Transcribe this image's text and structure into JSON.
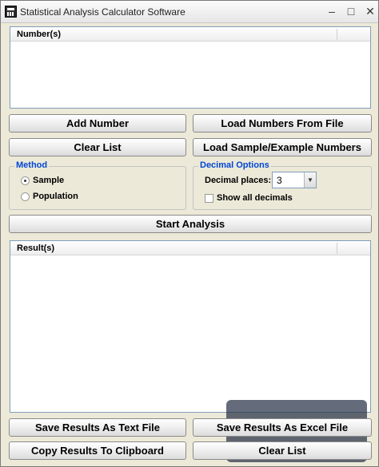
{
  "window": {
    "title": "Statistical Analysis Calculator Software",
    "minimize": "–",
    "maximize": "□",
    "close": "✕"
  },
  "numbers_panel": {
    "header": "Number(s)"
  },
  "buttons": {
    "add_number": "Add Number",
    "load_from_file": "Load Numbers From File",
    "clear_list": "Clear List",
    "load_sample": "Load Sample/Example Numbers",
    "start_analysis": "Start Analysis",
    "save_text": "Save Results As Text File",
    "save_excel": "Save Results As Excel File",
    "copy_clipboard": "Copy Results To Clipboard",
    "clear_list_bottom": "Clear List"
  },
  "method": {
    "legend": "Method",
    "options": [
      "Sample",
      "Population"
    ],
    "selected": "Sample"
  },
  "decimal_options": {
    "legend": "Decimal Options",
    "places_label": "Decimal places:",
    "places_value": "3",
    "show_all_label": "Show all decimals",
    "show_all_checked": false
  },
  "results_panel": {
    "header": "Result(s)"
  },
  "icons": {
    "app": "calculator-icon",
    "dropdown": "chevron-down-icon"
  },
  "colors": {
    "legend": "#0046d5",
    "window_bg": "#ece9d8",
    "panel_border": "#7f9db9"
  }
}
